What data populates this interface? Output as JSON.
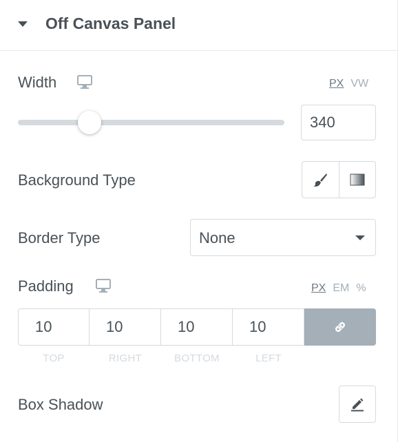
{
  "section": {
    "title": "Off Canvas Panel",
    "expanded": true
  },
  "width_control": {
    "label": "Width",
    "device_icon": "desktop-icon",
    "units": [
      "PX",
      "VW"
    ],
    "active_unit": "PX",
    "value": "340",
    "slider_fraction": 0.27
  },
  "background_type": {
    "label": "Background Type",
    "options": [
      "brush-icon",
      "gradient-icon"
    ]
  },
  "border_type": {
    "label": "Border Type",
    "selected": "None"
  },
  "padding": {
    "label": "Padding",
    "device_icon": "desktop-icon",
    "units": [
      "PX",
      "EM",
      "%"
    ],
    "active_unit": "PX",
    "values": {
      "top": "10",
      "right": "10",
      "bottom": "10",
      "left": "10"
    },
    "sides": [
      "TOP",
      "RIGHT",
      "BOTTOM",
      "LEFT"
    ],
    "linked": true,
    "link_icon": "link-icon"
  },
  "box_shadow": {
    "label": "Box Shadow",
    "edit_icon": "pencil-icon"
  },
  "colors": {
    "text": "#495157",
    "border": "#d5dadf",
    "link_button": "#a4afb7",
    "muted": "#a4afb7"
  }
}
